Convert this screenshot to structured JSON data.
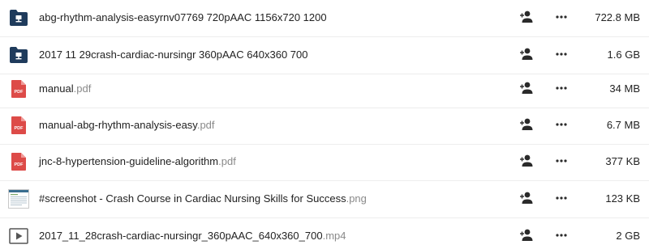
{
  "colors": {
    "folder": "#1f3b5c",
    "pdf": "#dd4b48",
    "icon": "#2a2a2a",
    "extension": "#8a8a8a"
  },
  "files": [
    {
      "icon": "folder-icon",
      "name": "abg-rhythm-analysis-easyrnv07769 720pAAC 1156x720 1200",
      "ext": "",
      "size": "722.8 MB"
    },
    {
      "icon": "folder-icon",
      "name": "2017 11 29crash-cardiac-nursingr 360pAAC 640x360 700",
      "ext": "",
      "size": "1.6 GB"
    },
    {
      "icon": "pdf-icon",
      "badge": "PDF",
      "name": "manual",
      "ext": ".pdf",
      "size": "34 MB"
    },
    {
      "icon": "pdf-icon",
      "badge": "PDF",
      "name": "manual-abg-rhythm-analysis-easy",
      "ext": ".pdf",
      "size": "6.7 MB"
    },
    {
      "icon": "pdf-icon",
      "badge": "PDF",
      "name": "jnc-8-hypertension-guideline-algorithm",
      "ext": ".pdf",
      "size": "377 KB"
    },
    {
      "icon": "image-thumbnail",
      "name": "#screenshot - Crash Course in Cardiac Nursing Skills for Success",
      "ext": ".png",
      "size": "123 KB"
    },
    {
      "icon": "video-icon",
      "name": "2017_11_28crash-cardiac-nursingr_360pAAC_640x360_700",
      "ext": ".mp4",
      "size": "2 GB"
    }
  ]
}
